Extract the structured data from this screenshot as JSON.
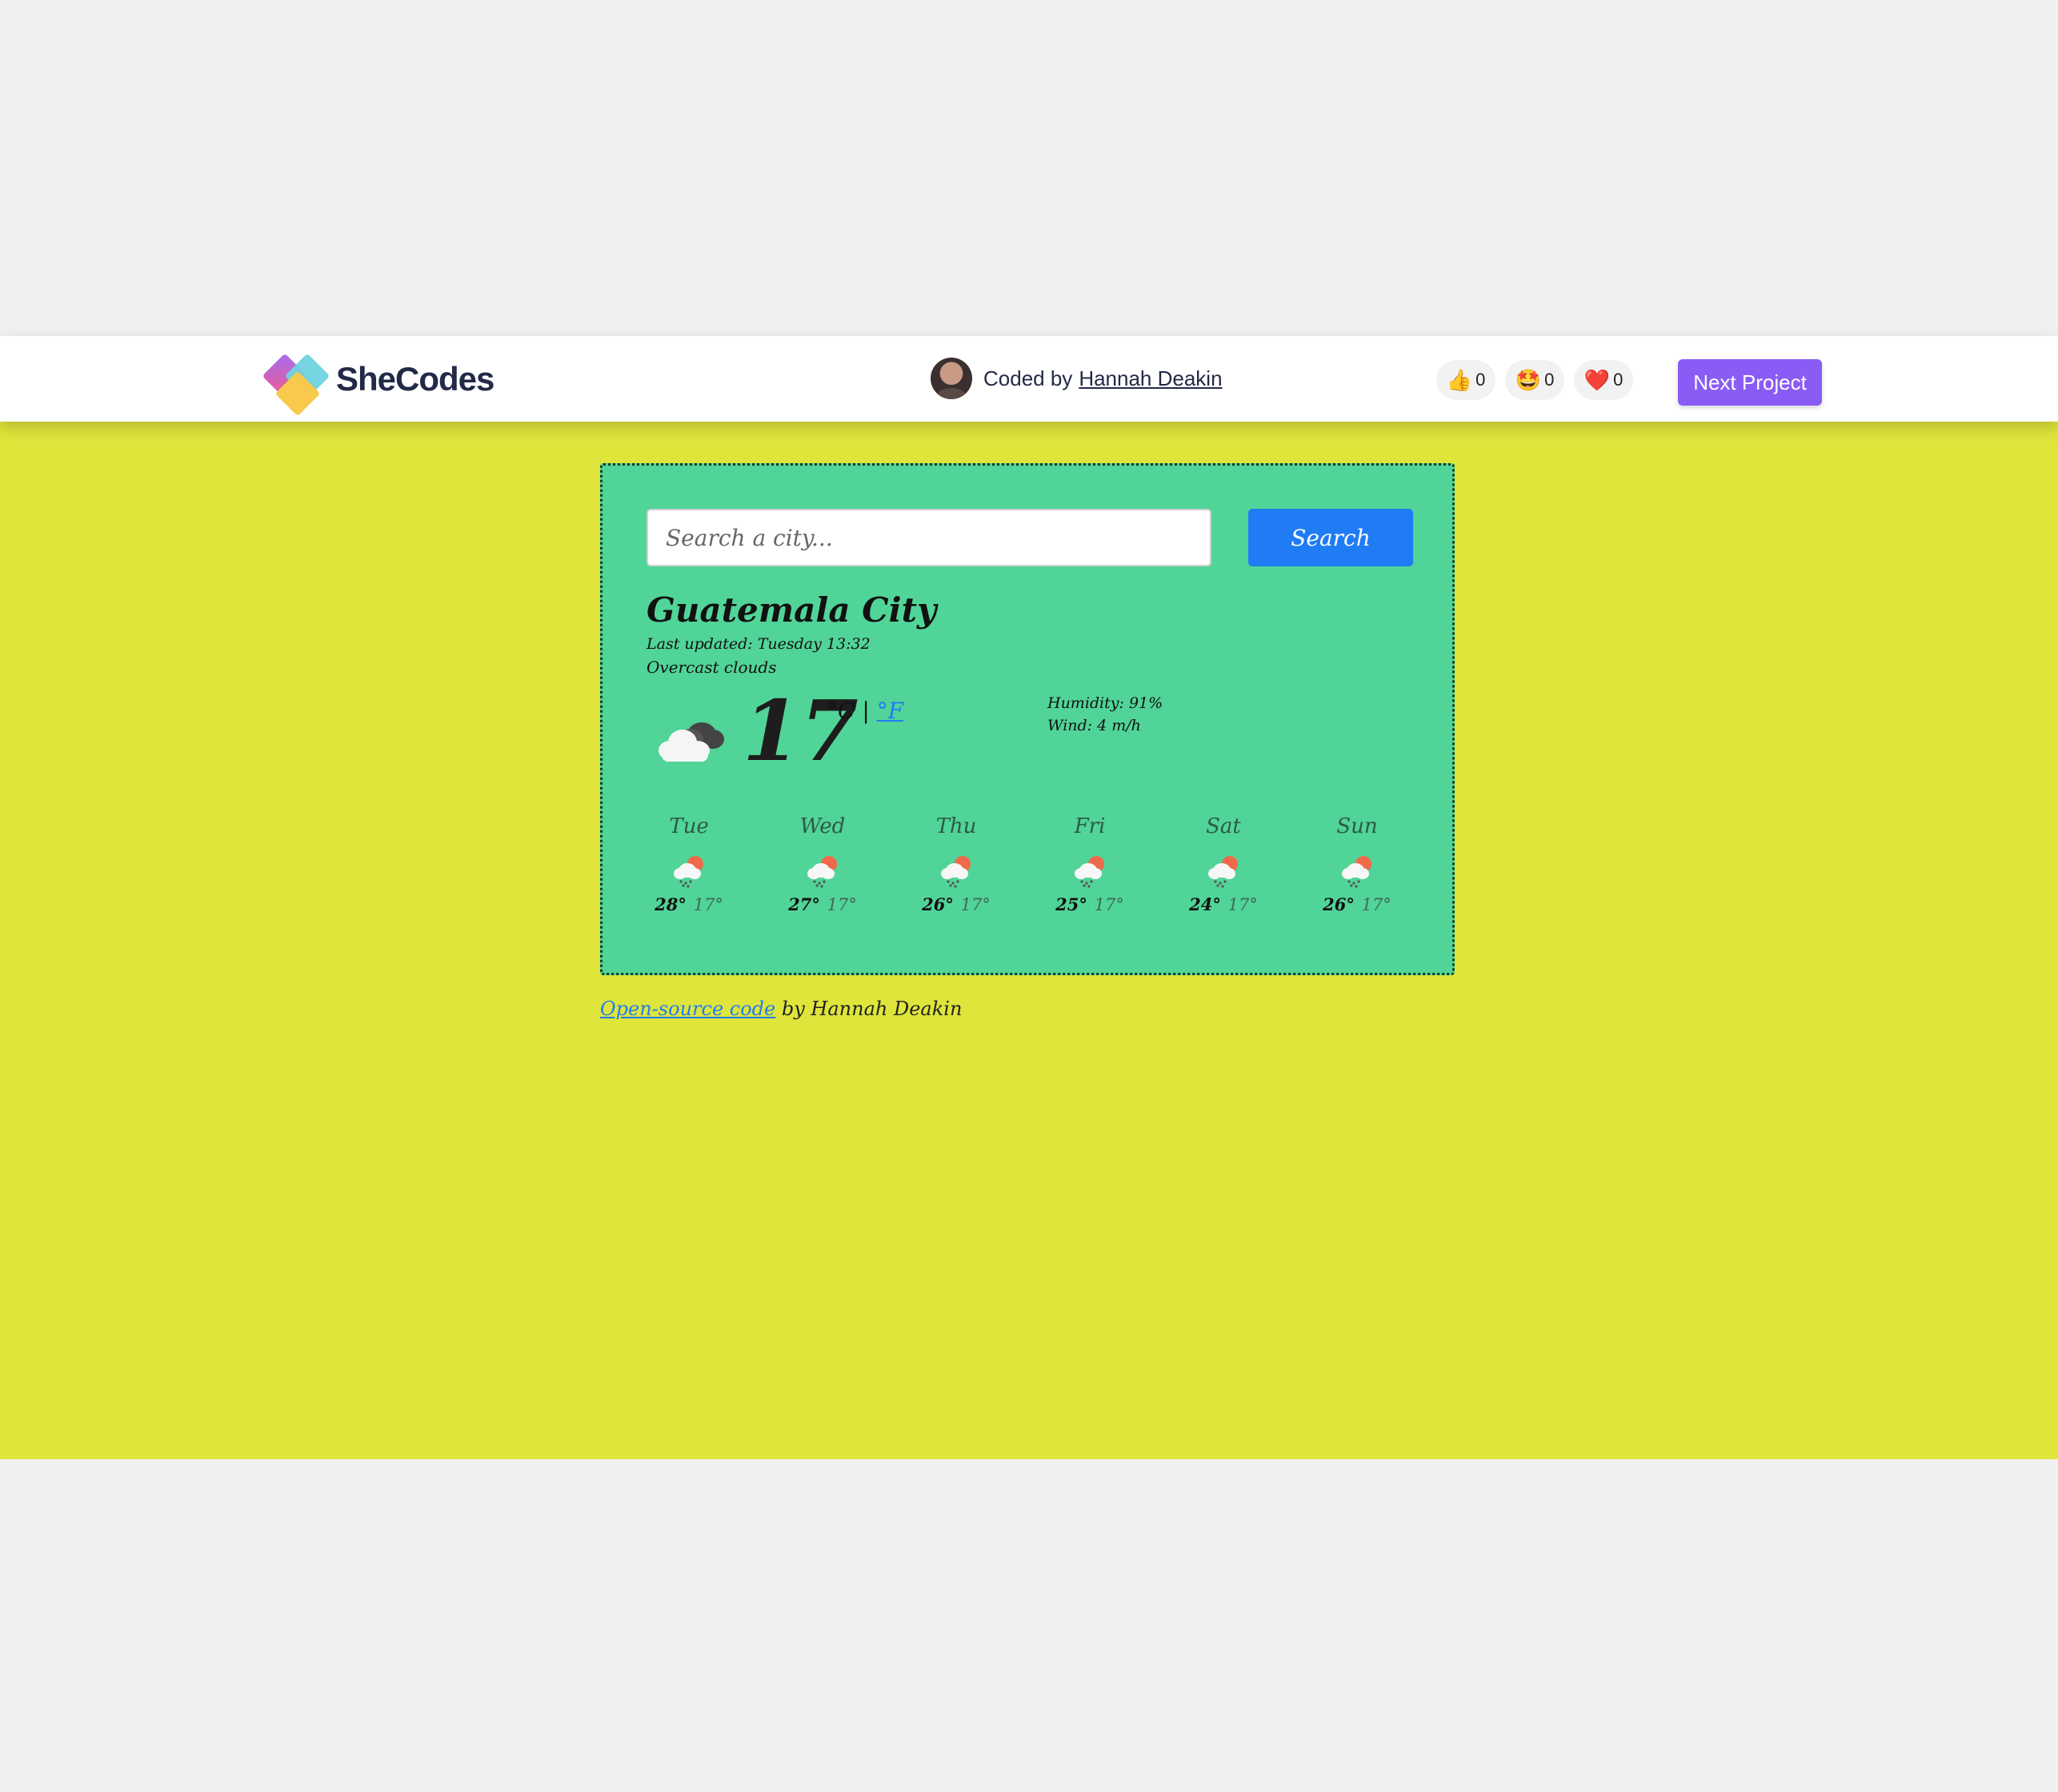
{
  "header": {
    "logo_text": "SheCodes",
    "coded_by_prefix": "Coded by",
    "author_name": "Hannah Deakin",
    "reactions": [
      {
        "icon": "thumbs-up-icon",
        "emoji": "👍",
        "count": "0"
      },
      {
        "icon": "star-struck-icon",
        "emoji": "🤩",
        "count": "0"
      },
      {
        "icon": "heart-icon",
        "emoji": "❤️",
        "count": "0"
      }
    ],
    "next_label": "Next Project"
  },
  "search": {
    "placeholder": "Search a city...",
    "button_label": "Search"
  },
  "current": {
    "city": "Guatemala City",
    "last_updated": "Last updated: Tuesday 13:32",
    "description": "Overcast clouds",
    "icon": "overcast-cloud-icon",
    "temperature": "17",
    "unit_c": "°C",
    "separator": "|",
    "unit_f": "°F",
    "humidity": "Humidity: 91%",
    "wind": "Wind: 4 m/h"
  },
  "forecast": [
    {
      "day": "Tue",
      "icon": "rain-sun-icon",
      "high": "28°",
      "low": "17°"
    },
    {
      "day": "Wed",
      "icon": "rain-sun-icon",
      "high": "27°",
      "low": "17°"
    },
    {
      "day": "Thu",
      "icon": "rain-sun-icon",
      "high": "26°",
      "low": "17°"
    },
    {
      "day": "Fri",
      "icon": "rain-sun-icon",
      "high": "25°",
      "low": "17°"
    },
    {
      "day": "Sat",
      "icon": "rain-sun-icon",
      "high": "24°",
      "low": "17°"
    },
    {
      "day": "Sun",
      "icon": "rain-sun-icon",
      "high": "26°",
      "low": "17°"
    }
  ],
  "footer": {
    "link_text": "Open-source code",
    "suffix": "by Hannah Deakin"
  },
  "colors": {
    "page_background": "#dfe53b",
    "card_background": "#51d498",
    "search_button": "#1f7cf5",
    "next_button": "#8a5cf6"
  }
}
